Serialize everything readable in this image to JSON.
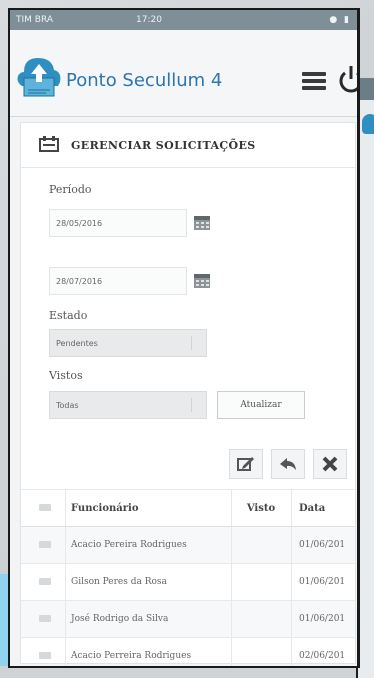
{
  "status_bar": {
    "carrier": "TIM BRA",
    "time": "17:20"
  },
  "app": {
    "title": "Ponto Secullum 4"
  },
  "panel": {
    "title": "GERENCIAR SOLICITAÇÕES"
  },
  "filters": {
    "periodo_label": "Período",
    "date_from": "28/05/2016",
    "date_to": "28/07/2016",
    "estado_label": "Estado",
    "estado_value": "Pendentes",
    "vistos_label": "Vistos",
    "vistos_value": "Todas",
    "atualizar_label": "Atualizar"
  },
  "actions": [
    "edit-icon",
    "reply-icon",
    "close-icon"
  ],
  "table": {
    "headers": {
      "funcionario": "Funcionário",
      "visto": "Visto",
      "data": "Data"
    },
    "rows": [
      {
        "funcionario": "Acacio Pereira Rodrigues",
        "visto": "",
        "data": "01/06/201"
      },
      {
        "funcionario": "Gilson Peres da Rosa",
        "visto": "",
        "data": "01/06/201"
      },
      {
        "funcionario": "José Rodrigo da Silva",
        "visto": "",
        "data": "01/06/201"
      },
      {
        "funcionario": "Acacio Perreira Rodrigues",
        "visto": "",
        "data": "02/06/201"
      }
    ]
  },
  "colors": {
    "brand_blue": "#2c74b3",
    "status_bar": "#7e8f98"
  }
}
